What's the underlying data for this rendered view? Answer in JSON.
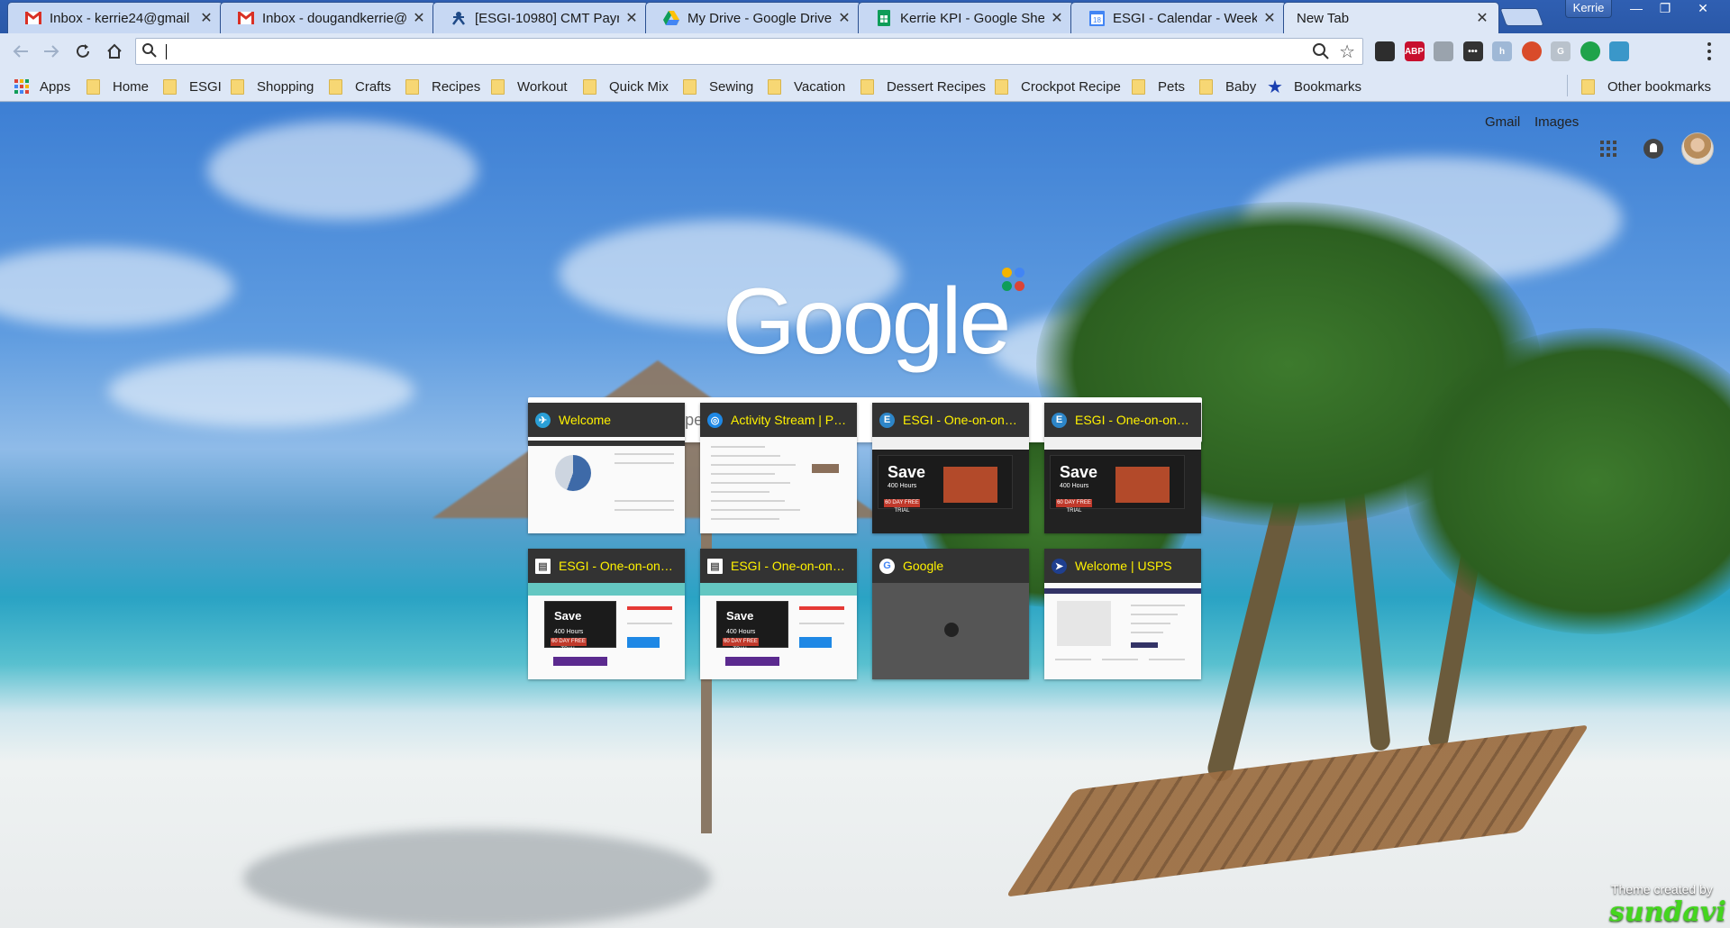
{
  "tabs": [
    {
      "title": "Inbox - kerrie24@gmail",
      "icon": "gmail-icon",
      "active": false
    },
    {
      "title": "Inbox - dougandkerrie@",
      "icon": "gmail-icon",
      "active": false
    },
    {
      "title": "[ESGI-10980] CMT Paym",
      "icon": "jira-icon",
      "active": false
    },
    {
      "title": "My Drive - Google Drive",
      "icon": "google-drive-icon",
      "active": false
    },
    {
      "title": "Kerrie KPI - Google Shee",
      "icon": "google-sheets-icon",
      "active": false
    },
    {
      "title": "ESGI - Calendar - Week",
      "icon": "google-calendar-icon",
      "active": false
    },
    {
      "title": "New Tab",
      "icon": "",
      "active": true
    }
  ],
  "tab_close_glyph": "✕",
  "profile_name": "Kerrie",
  "window_controls": {
    "minimize": "—",
    "restore": "❐",
    "close": "✕"
  },
  "calendar_day": "18",
  "omnibox": {
    "value": "",
    "placeholder": ""
  },
  "extensions": [
    {
      "name": "todoist-icon",
      "label": "",
      "color": "#2d2d2d"
    },
    {
      "name": "adblock-plus-icon",
      "label": "ABP",
      "color": "#c8102e"
    },
    {
      "name": "google-drive-ext-icon",
      "label": "",
      "color": "#9aa3ad"
    },
    {
      "name": "ellipsis-ext-icon",
      "label": "•••",
      "color": "#333333"
    },
    {
      "name": "honey-ext-icon",
      "label": "h",
      "color": "#9fb8d6"
    },
    {
      "name": "color-picker-ext-icon",
      "label": "",
      "color": "#d94b2a"
    },
    {
      "name": "grammarly-ext-icon",
      "label": "G",
      "color": "#b9c2cc"
    },
    {
      "name": "green-dot-ext-icon",
      "label": "",
      "color": "#1fa34a"
    },
    {
      "name": "pinwheel-ext-icon",
      "label": "",
      "color": "#3a97c9"
    }
  ],
  "bookmarks": {
    "apps": "Apps",
    "items": [
      "Home",
      "ESGI",
      "Shopping",
      "Crafts",
      "Recipes",
      "Workout",
      "Quick Mix",
      "Sewing",
      "Vacation",
      "Dessert Recipes",
      "Crockpot Recipe",
      "Pets",
      "Baby"
    ],
    "starred": "Bookmarks",
    "other": "Other bookmarks"
  },
  "ntp": {
    "links": {
      "gmail": "Gmail",
      "images": "Images"
    },
    "logo_text": "Google",
    "logo_dot_colors": [
      "#f4b400",
      "#4285f4",
      "#0f9d58",
      "#db4437"
    ],
    "search_placeholder": "Search Google or type URL",
    "tiles": [
      {
        "title": "Welcome",
        "icon_color": "#2a9fd6",
        "icon_glyph": "✈",
        "thumb": "welcome"
      },
      {
        "title": "Activity Stream | Po...",
        "icon_color": "#1e88e5",
        "icon_glyph": "◎",
        "thumb": "activity"
      },
      {
        "title": "ESGI - One-on-one ...",
        "icon_color": "#2d86c9",
        "icon_glyph": "E",
        "thumb": "esgi-dark"
      },
      {
        "title": "ESGI - One-on-one ...",
        "icon_color": "#2d86c9",
        "icon_glyph": "E",
        "thumb": "esgi-dark"
      },
      {
        "title": "ESGI - One-on-one ...",
        "icon_color": "#ffffff",
        "icon_glyph": "▤",
        "thumb": "esgi-light"
      },
      {
        "title": "ESGI - One-on-one ...",
        "icon_color": "#ffffff",
        "icon_glyph": "▤",
        "thumb": "esgi-light2"
      },
      {
        "title": "Google",
        "icon_color": "#ffffff",
        "icon_glyph": "G",
        "thumb": "google"
      },
      {
        "title": "Welcome | USPS",
        "icon_color": "#1f3f8f",
        "icon_glyph": "➤",
        "thumb": "usps"
      }
    ],
    "thumb_text": {
      "save": "Save",
      "save_sub": "400 Hours",
      "save_badge": "60 DAY FREE TRIAL"
    },
    "theme_credit": "Theme created by",
    "theme_author": "sundavi"
  }
}
